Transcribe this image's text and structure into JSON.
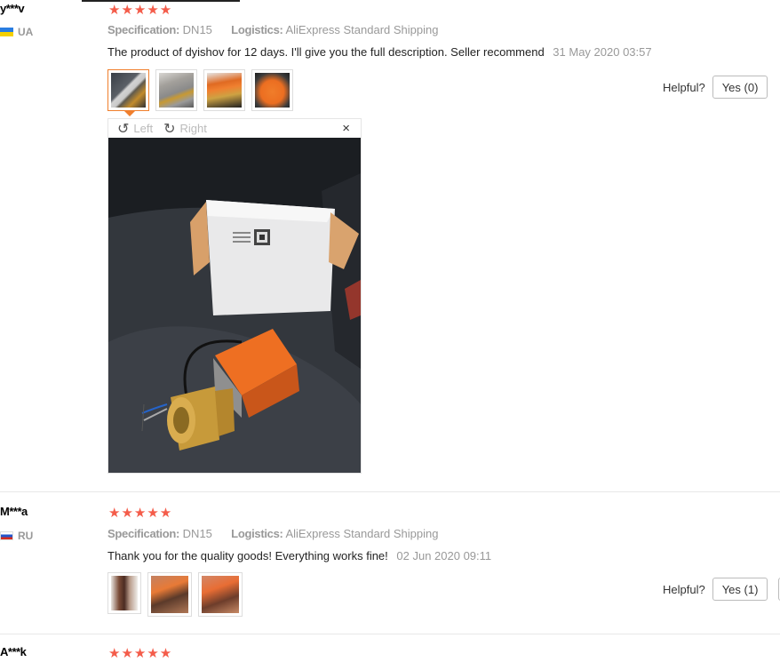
{
  "reviews": [
    {
      "user": "y***v",
      "country": "UA",
      "stars": "★★★★★",
      "spec_label": "Specification:",
      "spec_value": "DN15",
      "logistics_label": "Logistics:",
      "logistics_value": "AliExpress Standard Shipping",
      "text": "The product of dyishov for 12 days. I'll give you the full description. Seller recommend",
      "date": "31 May 2020 03:57",
      "helpful_label": "Helpful?",
      "yes_label": "Yes (0)",
      "thumbnails": [
        "valve-box-photo",
        "valve-closeup-photo",
        "actuator-photo",
        "actuator-orange-photo"
      ]
    },
    {
      "user": "M***a",
      "country": "RU",
      "stars": "★★★★★",
      "spec_label": "Specification:",
      "spec_value": "DN15",
      "logistics_label": "Logistics:",
      "logistics_value": "AliExpress Standard Shipping",
      "text": "Thank you for the quality goods! Everything works fine!",
      "date": "02 Jun 2020 09:11",
      "helpful_label": "Helpful?",
      "yes_label": "Yes (1)",
      "thumbnails": [
        "valve-in-hand-photo",
        "actuator-wired-photo",
        "actuator-mounted-photo"
      ]
    },
    {
      "user": "A***k",
      "stars": "★★★★★"
    }
  ],
  "viewer": {
    "rotate_left_label": "Left",
    "rotate_right_label": "Right",
    "close_symbol": "×",
    "rotate_left_icon": "rotate-left-icon",
    "rotate_right_icon": "rotate-right-icon"
  },
  "colors": {
    "star": "#f45c4a",
    "active_thumb": "#f07f2d"
  }
}
